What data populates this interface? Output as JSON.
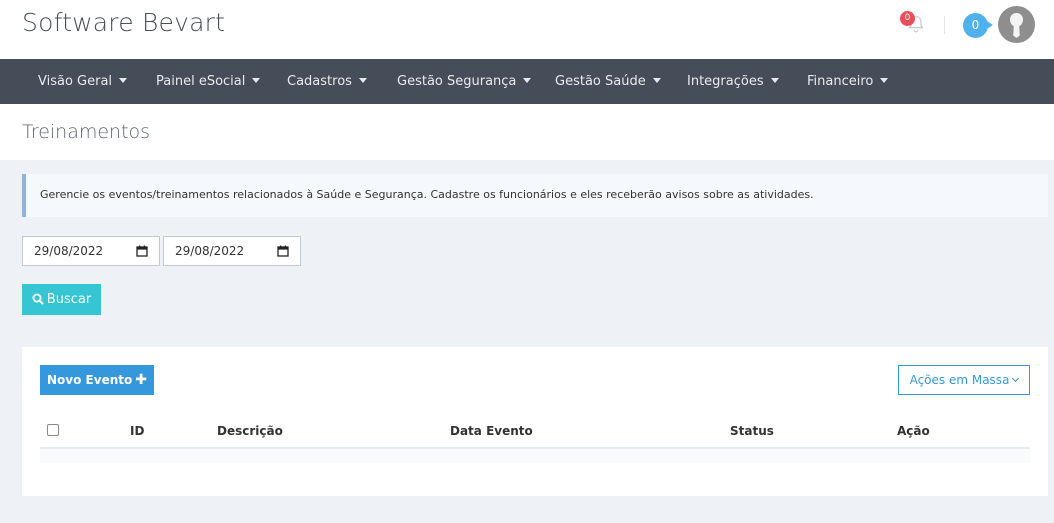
{
  "header": {
    "brand": "Software Bevart",
    "notifications_count": "0",
    "tasks_count": "0"
  },
  "nav": {
    "items": [
      {
        "label": "Visão Geral"
      },
      {
        "label": "Painel eSocial"
      },
      {
        "label": "Cadastros"
      },
      {
        "label": "Gestão Segurança"
      },
      {
        "label": "Gestão Saúde"
      },
      {
        "label": "Integrações"
      },
      {
        "label": "Financeiro"
      }
    ]
  },
  "page": {
    "title": "Treinamentos",
    "note": "Gerencie os eventos/treinamentos relacionados à Saúde e Segurança. Cadastre os funcionários e eles receberão avisos sobre as atividades."
  },
  "filters": {
    "date_start": "29/08/2022",
    "date_end": "29/08/2022",
    "search_label": "Buscar"
  },
  "panel": {
    "new_event_label": "Novo Evento",
    "bulk_actions_label": "Ações em Massa",
    "columns": [
      "ID",
      "Descrição",
      "Data Evento",
      "Status",
      "Ação"
    ]
  },
  "colors": {
    "navbar": "#444d58",
    "primary": "#3598dc",
    "search_button": "#36c6d3",
    "notification_badge": "#e7505a",
    "count_badge": "#4fb2ef"
  },
  "icons": {
    "bell": "bell-icon",
    "search": "search-icon",
    "calendar": "calendar-icon",
    "plus": "plus-icon",
    "avatar": "user-avatar-icon"
  }
}
